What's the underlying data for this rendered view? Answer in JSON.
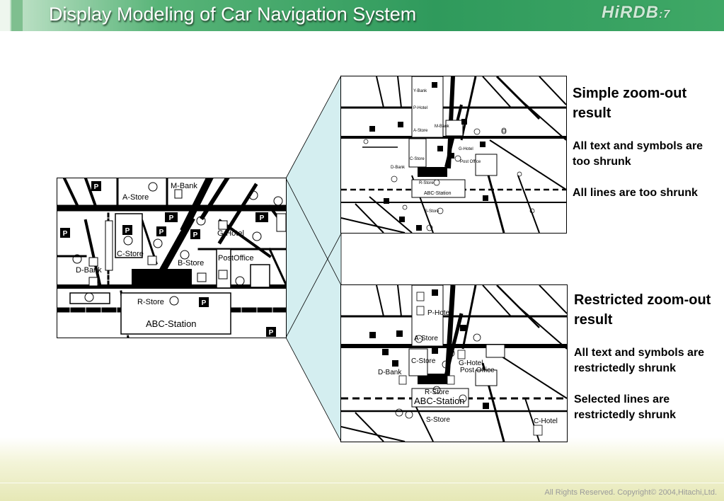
{
  "header": {
    "title": "Display Modeling of Car Navigation System",
    "logo_text": "HiRDB",
    "logo_version": "7"
  },
  "simple": {
    "heading": "Simple zoom-out result",
    "note1": "All text and symbols are too shrunk",
    "note2": "All lines are too shrunk"
  },
  "restricted": {
    "heading": "Restricted zoom-out result",
    "note1": "All text and symbols are restrictedly shrunk",
    "note2": "Selected  lines are restrictedly shrunk"
  },
  "maps": {
    "original": {
      "labels": [
        "A-Store",
        "M-Bank",
        "C-Store",
        "D-Bank",
        "B-Store",
        "G-Hotel",
        "PostOffice",
        "R-Store",
        "ABC-Station"
      ]
    },
    "simple": {
      "labels": [
        "Y-Bank",
        "P-Hotel",
        "A-Store",
        "M-Bank",
        "C-Store",
        "G-Hotel",
        "D-Bank",
        "Post Office",
        "R-Store",
        "ABC-Station",
        "S-Store"
      ]
    },
    "restricted": {
      "labels": [
        "P-Hotel",
        "A-Store",
        "C-Store",
        "G-Hotel",
        "Post Office",
        "D-Bank",
        "R-Store",
        "ABC-Station",
        "S-Store",
        "C-Hotel"
      ]
    }
  },
  "footer": {
    "copyright": "All Rights Reserved. Copyright© 2004,Hitachi,Ltd."
  },
  "colors": {
    "header_green": "#2f9a5c",
    "zoom_cone": "#d4eef0"
  }
}
